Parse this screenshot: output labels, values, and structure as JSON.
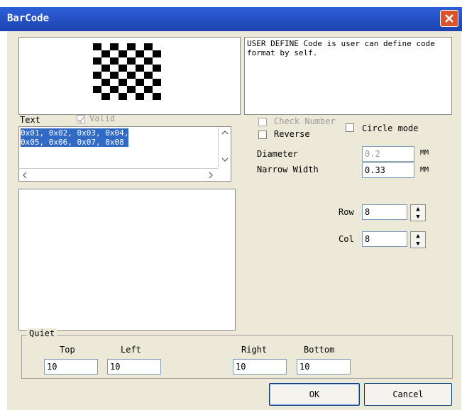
{
  "window": {
    "title": "BarCode"
  },
  "description": "USER DEFINE Code is user can define code format by self.",
  "text_section": {
    "label": "Text",
    "valid_label": "Valid",
    "valid_checked": true,
    "lines": [
      "0x01, 0x02, 0x03, 0x04,",
      "0x05, 0x06, 0x07, 0x08"
    ]
  },
  "options": {
    "check_number": "Check Number",
    "reverse": "Reverse",
    "circle_mode": "Circle mode"
  },
  "diameter": {
    "label": "Diameter",
    "value": "0.2",
    "unit": "MM"
  },
  "narrow_width": {
    "label": "Narrow Width",
    "value": "0.33",
    "unit": "MM"
  },
  "row": {
    "label": "Row",
    "value": "8"
  },
  "col": {
    "label": "Col",
    "value": "8"
  },
  "quiet": {
    "label": "Quiet",
    "top": {
      "label": "Top",
      "value": "10"
    },
    "left": {
      "label": "Left",
      "value": "10"
    },
    "right": {
      "label": "Right",
      "value": "10"
    },
    "bottom": {
      "label": "Bottom",
      "value": "10"
    }
  },
  "buttons": {
    "ok": "OK",
    "cancel": "Cancel"
  },
  "colors": {
    "title_bar": "#1c43b0",
    "selection": "#316ac5",
    "dialog_bg": "#ece9d8"
  },
  "matrix": {
    "rows": 8,
    "cols": 8
  }
}
